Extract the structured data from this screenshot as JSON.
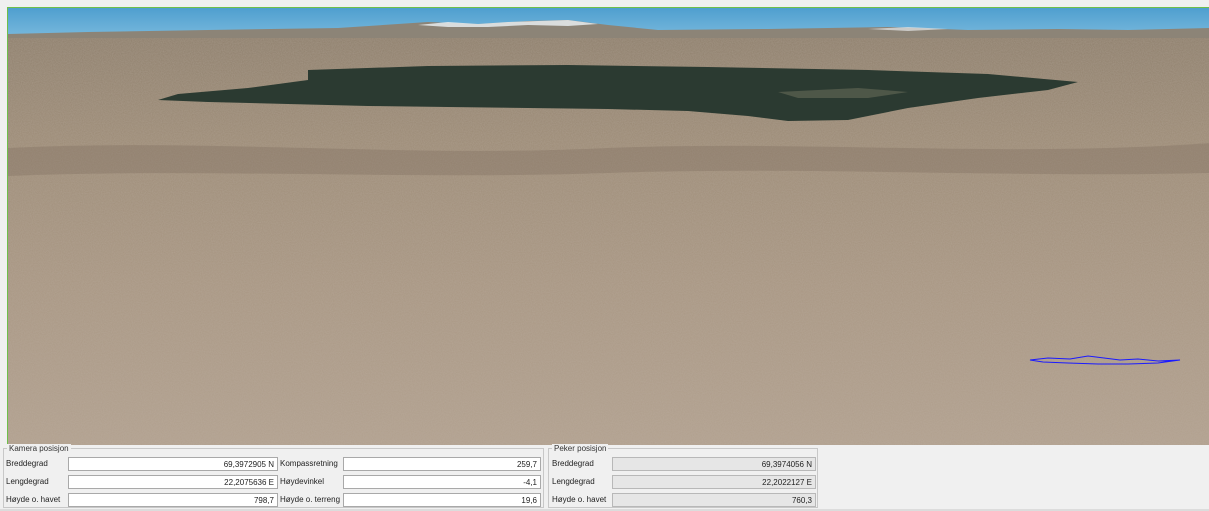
{
  "camera_panel": {
    "title": "Kamera posisjon",
    "rows": [
      {
        "label": "Breddegrad",
        "value": "69,3972905 N",
        "label2": "Kompassretning",
        "value2": "259,7"
      },
      {
        "label": "Lengdegrad",
        "value": "22,2075636 E",
        "label2": "Høydevinkel",
        "value2": "-4,1"
      },
      {
        "label": "Høyde o. havet",
        "value": "798,7",
        "label2": "Høyde o. terreng",
        "value2": "19,6"
      }
    ]
  },
  "pointer_panel": {
    "title": "Peker posisjon",
    "rows": [
      {
        "label": "Breddegrad",
        "value": "69,3974056 N"
      },
      {
        "label": "Lengdegrad",
        "value": "22,2022127 E"
      },
      {
        "label": "Høyde o. havet",
        "value": "760,3"
      }
    ]
  },
  "colors": {
    "sky": "#5fa8d3",
    "terrain": "#a79480",
    "lake": "#2d3a30",
    "track_line": "#1a1aff",
    "viewport_border": "#6fbf4a"
  }
}
